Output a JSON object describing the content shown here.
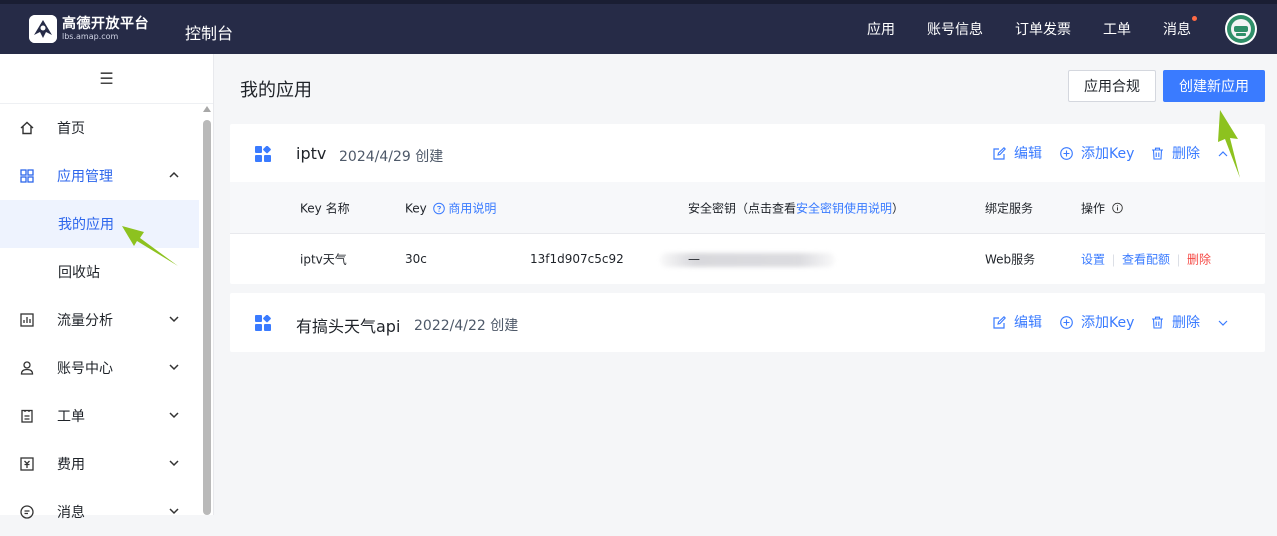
{
  "header": {
    "logo_cn": "高德开放平台",
    "logo_en": "lbs.amap.com",
    "console_label": "控制台",
    "nav": [
      "应用",
      "账号信息",
      "订单发票",
      "工单",
      "消息"
    ]
  },
  "sidebar": {
    "collapse_glyph": "☰",
    "items": [
      {
        "label": "首页",
        "icon": "home-icon"
      },
      {
        "label": "应用管理",
        "icon": "grid-icon"
      },
      {
        "label": "我的应用",
        "sub": true
      },
      {
        "label": "回收站",
        "sub": true
      },
      {
        "label": "流量分析",
        "icon": "chart-icon"
      },
      {
        "label": "账号中心",
        "icon": "user-icon"
      },
      {
        "label": "工单",
        "icon": "ticket-icon"
      },
      {
        "label": "费用",
        "icon": "billing-icon"
      },
      {
        "label": "消息",
        "icon": "message-icon"
      }
    ]
  },
  "main": {
    "title": "我的应用",
    "compliance_button": "应用合规",
    "create_button": "创建新应用",
    "actions": {
      "edit": "编辑",
      "add_key": "添加Key",
      "delete": "删除"
    },
    "apps": [
      {
        "name": "iptv",
        "created": "2024/4/29 创建",
        "expanded": true,
        "table": {
          "headers": {
            "key_name": "Key 名称",
            "key": "Key",
            "key_help": "商用说明",
            "secret_prefix": "安全密钥（点击查看",
            "secret_link": "安全密钥使用说明",
            "secret_suffix": "）",
            "service": "绑定服务",
            "ops": "操作"
          },
          "rows": [
            {
              "key_name": "iptv天气",
              "key_start": "30c",
              "key_end": "13f1d907c5c92",
              "secret": "—",
              "service": "Web服务",
              "op_settings": "设置",
              "op_quota": "查看配额",
              "op_delete": "删除"
            }
          ]
        }
      },
      {
        "name": "有搞头天气api",
        "created": "2022/4/22 创建",
        "expanded": false
      }
    ]
  },
  "colors": {
    "header_bg": "#262b47",
    "primary": "#3a7bff",
    "danger": "#f54a45",
    "annotation_arrow": "#8dc21f"
  }
}
